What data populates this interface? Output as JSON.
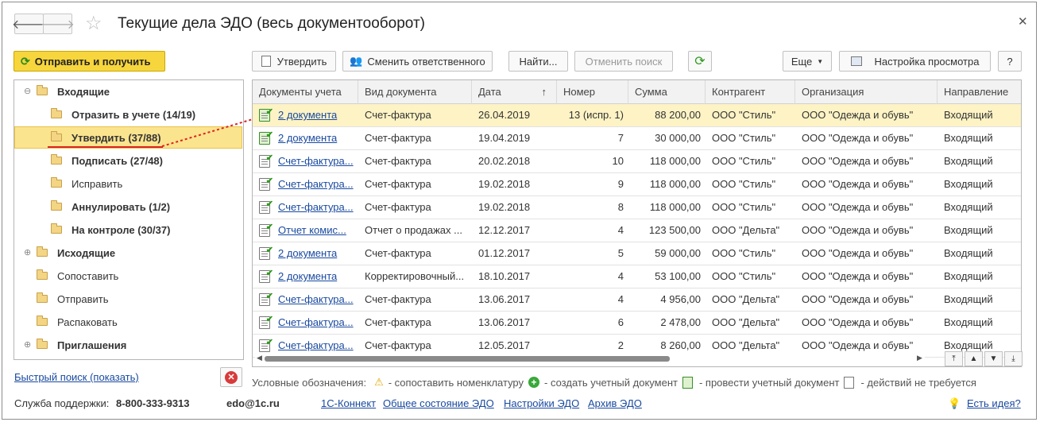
{
  "window": {
    "title": "Текущие дела ЭДО (весь документооборот)"
  },
  "left": {
    "send_receive": "Отправить и получить",
    "tree": [
      {
        "label": "Входящие",
        "bold": true,
        "level": 1,
        "expander": "⊖"
      },
      {
        "label": "Отразить в учете (14/19)",
        "bold": true,
        "level": 2
      },
      {
        "label": "Утвердить (37/88)",
        "bold": true,
        "level": 2,
        "selected": true
      },
      {
        "label": "Подписать (27/48)",
        "bold": true,
        "level": 2
      },
      {
        "label": "Исправить",
        "bold": false,
        "level": 2
      },
      {
        "label": "Аннулировать (1/2)",
        "bold": true,
        "level": 2
      },
      {
        "label": "На контроле (30/37)",
        "bold": true,
        "level": 2
      },
      {
        "label": "Исходящие",
        "bold": true,
        "level": 1,
        "expander": "⊕"
      },
      {
        "label": "Сопоставить",
        "bold": false,
        "level": 1
      },
      {
        "label": "Отправить",
        "bold": false,
        "level": 1
      },
      {
        "label": "Распаковать",
        "bold": false,
        "level": 1
      },
      {
        "label": "Приглашения",
        "bold": true,
        "level": 1,
        "expander": "⊕"
      }
    ],
    "quick_search": "Быстрый поиск (показать)"
  },
  "toolbar": {
    "approve": "Утвердить",
    "change_responsible": "Сменить ответственного",
    "find": "Найти...",
    "cancel_search": "Отменить поиск",
    "more": "Еще",
    "view_settings": "Настройка просмотра",
    "help": "?"
  },
  "table": {
    "columns": [
      "Документы учета",
      "Вид документа",
      "Дата",
      "Номер",
      "Сумма",
      "Контрагент",
      "Организация",
      "Направление"
    ],
    "sort_marker": "↑",
    "rows": [
      {
        "doc": "2 документа",
        "type": "Счет-фактура",
        "date": "26.04.2019",
        "num": "13 (испр. 1)",
        "sum": "88 200,00",
        "partner": "ООО \"Стиль\"",
        "org": "ООО \"Одежда и обувь\"",
        "dir": "Входящий",
        "icon": "green",
        "selected": true
      },
      {
        "doc": "2 документа",
        "type": "Счет-фактура",
        "date": "19.04.2019",
        "num": "7",
        "sum": "30 000,00",
        "partner": "ООО \"Стиль\"",
        "org": "ООО \"Одежда и обувь\"",
        "dir": "Входящий",
        "icon": "green"
      },
      {
        "doc": "Счет-фактура...",
        "type": "Счет-фактура",
        "date": "20.02.2018",
        "num": "10",
        "sum": "118 000,00",
        "partner": "ООО \"Стиль\"",
        "org": "ООО \"Одежда и обувь\"",
        "dir": "Входящий",
        "icon": "doc"
      },
      {
        "doc": "Счет-фактура...",
        "type": "Счет-фактура",
        "date": "19.02.2018",
        "num": "9",
        "sum": "118 000,00",
        "partner": "ООО \"Стиль\"",
        "org": "ООО \"Одежда и обувь\"",
        "dir": "Входящий",
        "icon": "doc"
      },
      {
        "doc": "Счет-фактура...",
        "type": "Счет-фактура",
        "date": "19.02.2018",
        "num": "8",
        "sum": "118 000,00",
        "partner": "ООО \"Стиль\"",
        "org": "ООО \"Одежда и обувь\"",
        "dir": "Входящий",
        "icon": "doc"
      },
      {
        "doc": "Отчет комис...",
        "type": "Отчет о продажах ...",
        "date": "12.12.2017",
        "num": "4",
        "sum": "123 500,00",
        "partner": "ООО \"Дельта\"",
        "org": "ООО \"Одежда и обувь\"",
        "dir": "Входящий",
        "icon": "doc"
      },
      {
        "doc": "2 документа",
        "type": "Счет-фактура",
        "date": "01.12.2017",
        "num": "5",
        "sum": "59 000,00",
        "partner": "ООО \"Стиль\"",
        "org": "ООО \"Одежда и обувь\"",
        "dir": "Входящий",
        "icon": "doc"
      },
      {
        "doc": "2 документа",
        "type": "Корректировочный...",
        "date": "18.10.2017",
        "num": "4",
        "sum": "53 100,00",
        "partner": "ООО \"Стиль\"",
        "org": "ООО \"Одежда и обувь\"",
        "dir": "Входящий",
        "icon": "doc"
      },
      {
        "doc": "Счет-фактура...",
        "type": "Счет-фактура",
        "date": "13.06.2017",
        "num": "4",
        "sum": "4 956,00",
        "partner": "ООО \"Дельта\"",
        "org": "ООО \"Одежда и обувь\"",
        "dir": "Входящий",
        "icon": "doc"
      },
      {
        "doc": "Счет-фактура...",
        "type": "Счет-фактура",
        "date": "13.06.2017",
        "num": "6",
        "sum": "2 478,00",
        "partner": "ООО \"Дельта\"",
        "org": "ООО \"Одежда и обувь\"",
        "dir": "Входящий",
        "icon": "doc"
      },
      {
        "doc": "Счет-фактура...",
        "type": "Счет-фактура",
        "date": "12.05.2017",
        "num": "2",
        "sum": "8 260,00",
        "partner": "ООО \"Дельта\"",
        "org": "ООО \"Одежда и обувь\"",
        "dir": "Входящий",
        "icon": "doc"
      }
    ]
  },
  "legend": {
    "title": "Условные обозначения:",
    "items": [
      {
        "icon": "warning-icon",
        "text": "- сопоставить номенклатуру"
      },
      {
        "icon": "plus-circle-icon",
        "text": "- создать учетный документ"
      },
      {
        "icon": "post-document-icon",
        "text": "- провести учетный документ"
      },
      {
        "icon": "no-action-icon",
        "text": "- действий не требуется"
      }
    ]
  },
  "footer": {
    "support_label": "Служба поддержки:",
    "phone": "8-800-333-9313",
    "email": "edo@1c.ru",
    "links": [
      "1С-Коннект",
      "Общее состояние ЭДО",
      "Настройки ЭДО",
      "Архив ЭДО"
    ],
    "ideas": "Есть идея?"
  },
  "colors": {
    "accent_yellow": "#f7d53c",
    "link": "#1a4aa0",
    "selected_row": "#fdf3c5"
  }
}
